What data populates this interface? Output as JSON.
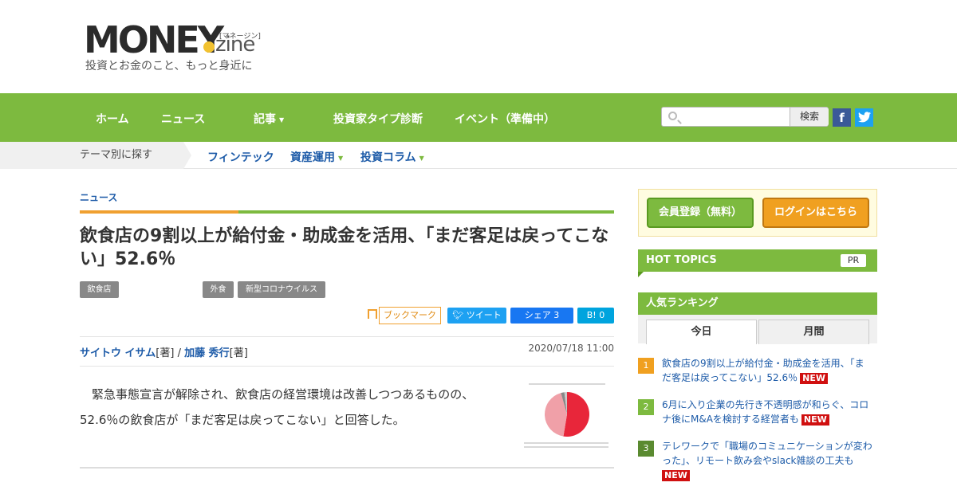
{
  "header": {
    "logo_word": "MONEY",
    "logo_zine": "zine",
    "logo_kana": "[マネージン]",
    "tagline": "投資とお金のこと、もっと身近に"
  },
  "gnav": {
    "items": [
      "ホーム",
      "ニュース",
      "記事",
      "投資家タイプ診断",
      "イベント（準備中）"
    ],
    "search_placeholder": "",
    "search_button": "検索",
    "facebook": "f",
    "twitter": "t"
  },
  "subnav": {
    "theme_label": "テーマ別に探す",
    "items": [
      "フィンテック",
      "資産運用",
      "投資コラム"
    ]
  },
  "article": {
    "category": "ニュース",
    "title": "飲食店の9割以上が給付金・助成金を活用、「まだ客足は戻ってこない」52.6％",
    "tags": [
      "飲食店",
      "外食",
      "新型コロナウイルス"
    ],
    "bookmark_label": "ブックマーク",
    "tweet_label": "ツイート",
    "share_label": "シェア 3",
    "hatena_label": "B! 0",
    "author1": "サイトウ イサム",
    "author1_role": "[著]",
    "separator": " / ",
    "author2": "加藤 秀行",
    "author2_role": "[著]",
    "date": "2020/07/18 11:00",
    "lead": "　緊急事態宣言が解除され、飲食店の経営環境は改善しつつあるものの、52.6％の飲食店が「まだ客足は戻ってこない」と回答した。"
  },
  "figure": {
    "pie_values": [
      52.6,
      43,
      2.5,
      1.9
    ],
    "colors": [
      "#e8263a",
      "#f0a0a8",
      "#888888",
      "#cccccc"
    ]
  },
  "sidebar": {
    "register_button": "会員登録（無料）",
    "login_button": "ログインはこちら",
    "hot_topics": "HOT TOPICS",
    "pr": "PR",
    "ranking_title": "人気ランキング",
    "tab_today": "今日",
    "tab_month": "月間",
    "new_badge": "NEW",
    "ranking": [
      {
        "num": "1",
        "text": "飲食店の9割以上が給付金・助成金を活用、「まだ客足は戻ってこない」52.6％"
      },
      {
        "num": "2",
        "text": "6月に入り企業の先行き不透明感が和らぐ、コロナ後にM&Aを検討する経営者も"
      },
      {
        "num": "3",
        "text": "テレワークで「職場のコミュニケーションが変わった」、リモート飲み会やslack雑談の工夫も"
      }
    ]
  }
}
